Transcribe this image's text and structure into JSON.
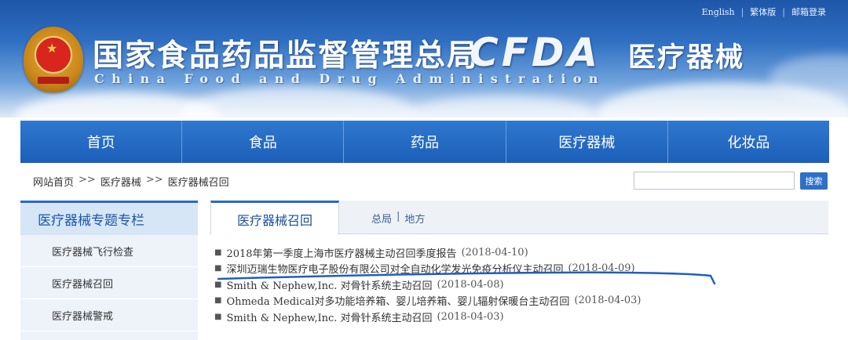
{
  "top_links": [
    "English",
    "繁体版",
    "邮箱登录"
  ],
  "banner": {
    "cn_title": "国家食品药品监督管理总局",
    "en_title": "China Food and Drug Administration",
    "logo_text": "CFDA",
    "section_title": "医疗器械"
  },
  "nav": [
    "首页",
    "食品",
    "药品",
    "医疗器械",
    "化妆品"
  ],
  "breadcrumb": [
    "网站首页",
    ">>",
    "医疗器械",
    ">>",
    "医疗器械召回"
  ],
  "search": {
    "value": "",
    "button_label": "搜索"
  },
  "sidebar": {
    "title": "医疗器械专题专栏",
    "items": [
      "医疗器械飞行检查",
      "医疗器械召回",
      "医疗器械警戒"
    ]
  },
  "main": {
    "tab_label": "医疗器械召回",
    "tab_links": [
      "总局",
      "|",
      "地方"
    ],
    "items": [
      {
        "title": "2018年第一季度上海市医疗器械主动召回季度报告",
        "date": "(2018-04-10)"
      },
      {
        "title": "深圳迈瑞生物医疗电子股份有限公司对全自动化学发光免疫分析仪主动召回",
        "date": "(2018-04-09)"
      },
      {
        "title": "Smith & Nephew,Inc. 对骨针系统主动召回",
        "date": "(2018-04-08)"
      },
      {
        "title": "Ohmeda Medical对多功能培养箱、婴儿培养箱、婴儿辐射保暖台主动召回",
        "date": "(2018-04-03)"
      },
      {
        "title": "Smith & Nephew,Inc. 对骨针系统主动召回",
        "date": "(2018-04-03)"
      }
    ]
  },
  "colors": {
    "brand_blue": "#1c5fb8",
    "annotation_line": "#1f5fbf"
  }
}
